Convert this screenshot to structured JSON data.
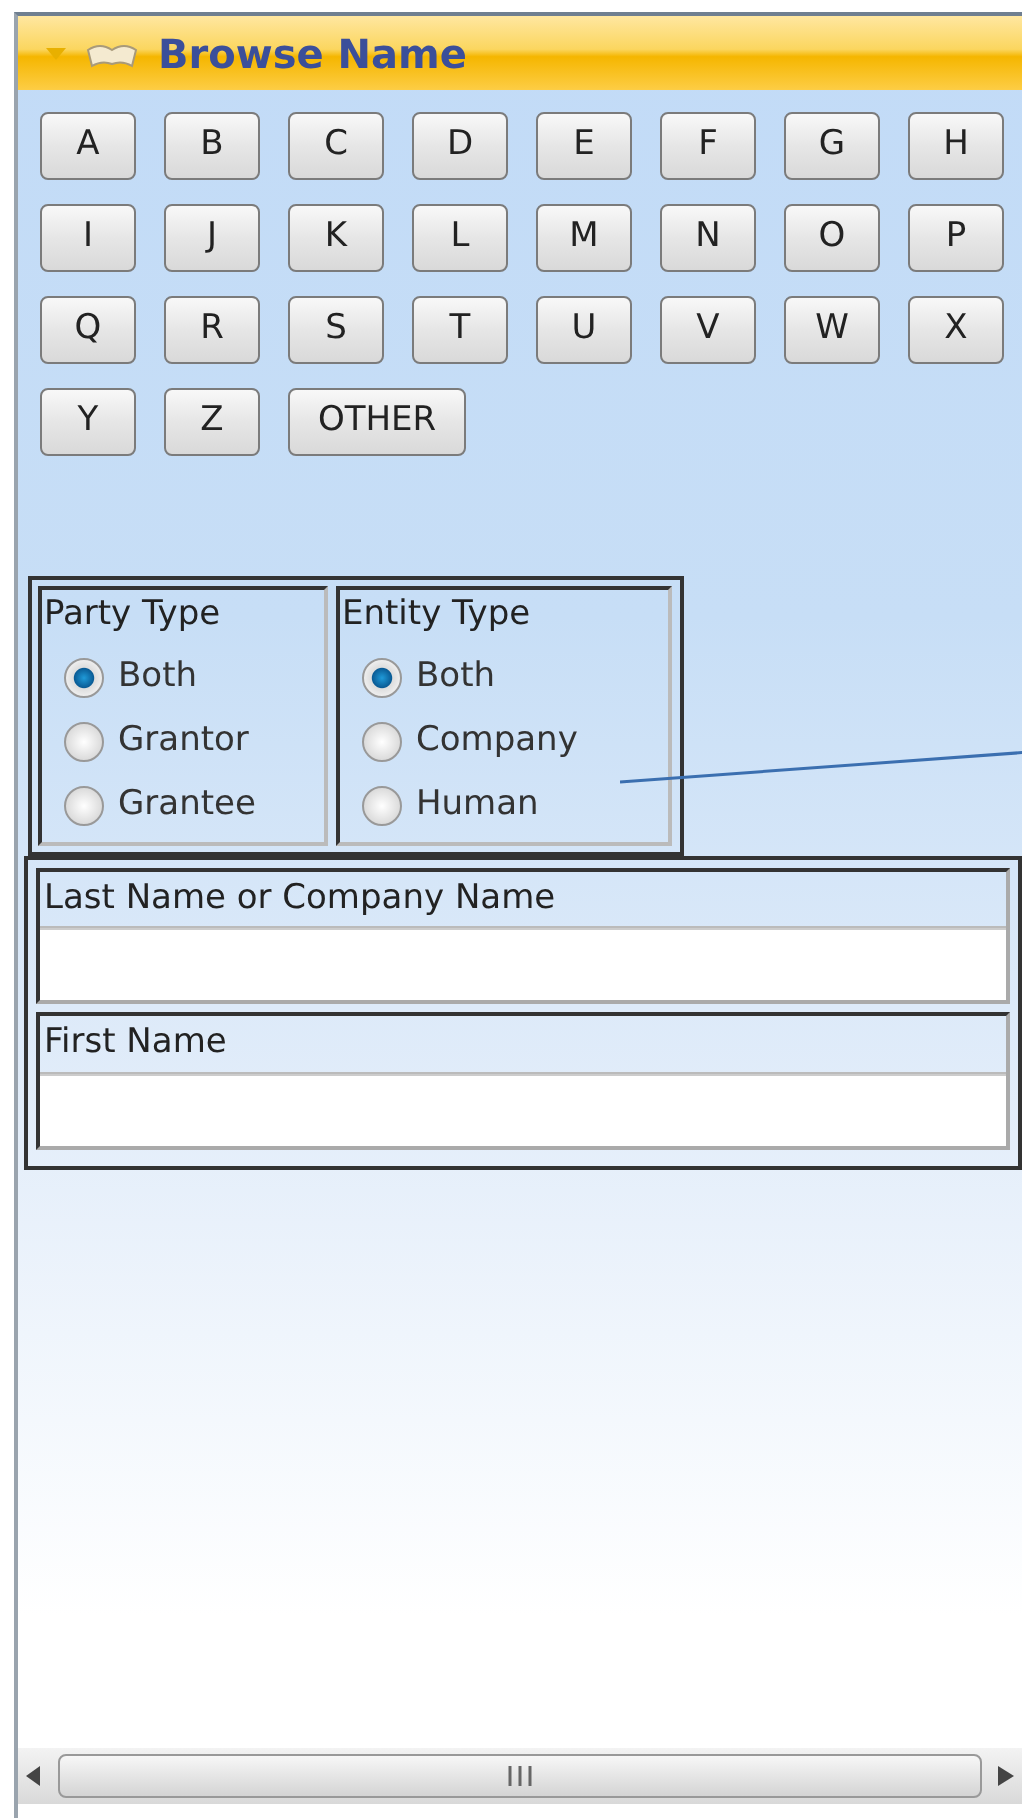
{
  "panel": {
    "title": "Browse Name"
  },
  "letter_buttons": [
    "A",
    "B",
    "C",
    "D",
    "E",
    "F",
    "G",
    "H",
    "I",
    "J",
    "K",
    "L",
    "M",
    "N",
    "O",
    "P",
    "Q",
    "R",
    "S",
    "T",
    "U",
    "V",
    "W",
    "X",
    "Y",
    "Z",
    "OTHER"
  ],
  "option_groups": [
    {
      "title": "Party Type",
      "options": [
        {
          "label": "Both",
          "selected": true
        },
        {
          "label": "Grantor",
          "selected": false
        },
        {
          "label": "Grantee",
          "selected": false
        }
      ]
    },
    {
      "title": "Entity Type",
      "options": [
        {
          "label": "Both",
          "selected": true
        },
        {
          "label": "Company",
          "selected": false
        },
        {
          "label": "Human",
          "selected": false
        }
      ]
    }
  ],
  "fields": [
    {
      "label": "Last Name or Company Name"
    },
    {
      "label": "First Name"
    }
  ]
}
